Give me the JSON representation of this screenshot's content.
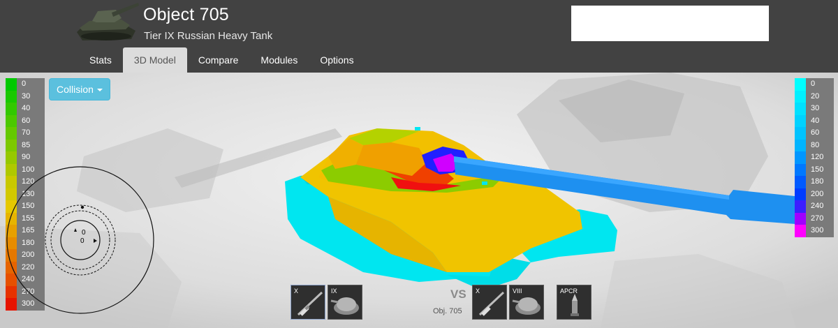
{
  "header": {
    "tank_name": "Object 705",
    "tank_subtitle": "Tier IX Russian Heavy Tank",
    "tank_thumb_icon": "heavy-tank-icon"
  },
  "tabs": [
    {
      "label": "Stats",
      "active": false
    },
    {
      "label": "3D Model",
      "active": true
    },
    {
      "label": "Compare",
      "active": false
    },
    {
      "label": "Modules",
      "active": false
    },
    {
      "label": "Options",
      "active": false
    }
  ],
  "viewer": {
    "collision_button": "Collision",
    "armor_legend": [
      {
        "value": "0",
        "color": "#00c800"
      },
      {
        "value": "30",
        "color": "#19c800"
      },
      {
        "value": "40",
        "color": "#32c800"
      },
      {
        "value": "60",
        "color": "#4bc800"
      },
      {
        "value": "70",
        "color": "#64c800"
      },
      {
        "value": "85",
        "color": "#7dc800"
      },
      {
        "value": "90",
        "color": "#96c800"
      },
      {
        "value": "100",
        "color": "#afc800"
      },
      {
        "value": "120",
        "color": "#c8c800"
      },
      {
        "value": "130",
        "color": "#d2c800"
      },
      {
        "value": "150",
        "color": "#e6c800"
      },
      {
        "value": "155",
        "color": "#e6b400"
      },
      {
        "value": "165",
        "color": "#e6a000"
      },
      {
        "value": "180",
        "color": "#e68c00"
      },
      {
        "value": "200",
        "color": "#e67800"
      },
      {
        "value": "220",
        "color": "#e66400"
      },
      {
        "value": "240",
        "color": "#e65000"
      },
      {
        "value": "270",
        "color": "#e63200"
      },
      {
        "value": "300",
        "color": "#e61400"
      }
    ],
    "penetration_legend": [
      {
        "value": "0",
        "color": "#00ffff"
      },
      {
        "value": "20",
        "color": "#00f0ff"
      },
      {
        "value": "30",
        "color": "#00e1ff"
      },
      {
        "value": "40",
        "color": "#00d2ff"
      },
      {
        "value": "60",
        "color": "#00c3ff"
      },
      {
        "value": "80",
        "color": "#00b4ff"
      },
      {
        "value": "120",
        "color": "#0096ff"
      },
      {
        "value": "150",
        "color": "#0078ff"
      },
      {
        "value": "180",
        "color": "#005aff"
      },
      {
        "value": "200",
        "color": "#003cff"
      },
      {
        "value": "240",
        "color": "#3c1eff"
      },
      {
        "value": "270",
        "color": "#a000ff"
      },
      {
        "value": "300",
        "color": "#ff00ff"
      }
    ],
    "compass": {
      "angle_top": "0",
      "angle_left": "0"
    },
    "vs_label": "VS",
    "vs_tank_name": "Obj. 705",
    "modules_left": [
      {
        "tier": "X",
        "icon": "gun-icon"
      },
      {
        "tier": "IX",
        "icon": "turret-icon"
      }
    ],
    "modules_right": [
      {
        "tier": "X",
        "icon": "gun-icon"
      },
      {
        "tier": "VIII",
        "icon": "turret-icon"
      },
      {
        "tier": "APCR",
        "icon": "shell-icon"
      }
    ]
  }
}
